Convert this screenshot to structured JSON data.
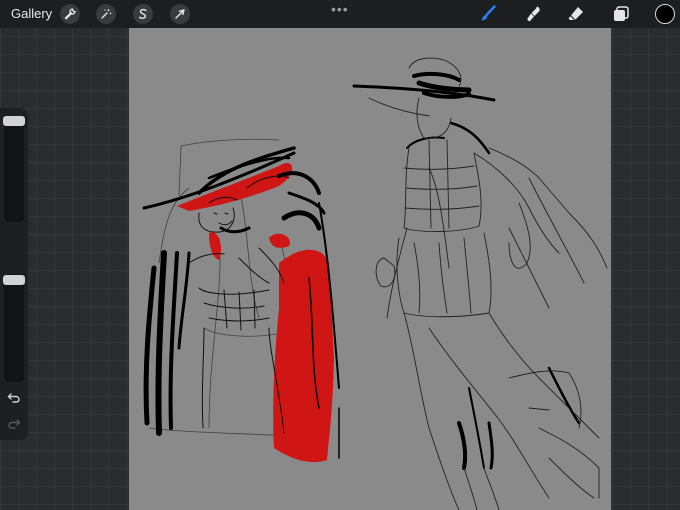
{
  "toolbar": {
    "gallery_label": "Gallery",
    "more_dots": "•••",
    "colors": {
      "bar_bg": "#1d1e20",
      "active_brush": "#2f7ef6",
      "icon": "#e6e6e6",
      "current_color": "#000000"
    },
    "left_tools": [
      "wrench-icon",
      "magic-wand-icon",
      "selection-s-icon",
      "transform-arrow-icon"
    ],
    "right_tools": [
      "brush-icon",
      "smudge-icon",
      "eraser-icon",
      "layers-icon",
      "color-swatch"
    ]
  },
  "sidebar": {
    "brush_size": 0.92,
    "opacity": 0.92,
    "icons": [
      "modify-square-icon",
      "undo-icon",
      "redo-icon"
    ]
  },
  "canvas": {
    "background": "#8a8a8a",
    "ink_red": "#d01515",
    "ink_black": "#000000"
  }
}
